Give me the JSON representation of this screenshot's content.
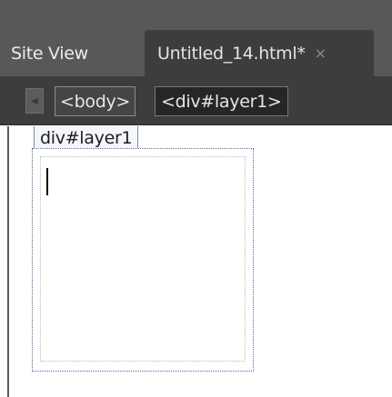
{
  "tabs": [
    {
      "label": "Site View",
      "active": false
    },
    {
      "label": "Untitled_14.html*",
      "active": true,
      "close_glyph": "×"
    }
  ],
  "tag_selector": {
    "nav_icon": "scroll-left-icon",
    "tags": [
      "<body>",
      "<div#layer1>"
    ]
  },
  "design_view": {
    "layer_label": "div#layer1"
  },
  "colors": {
    "tabbar_bg": "#585858",
    "active_tab_bg": "#3d3d3d",
    "selection_outline": "#4a6fa5"
  }
}
